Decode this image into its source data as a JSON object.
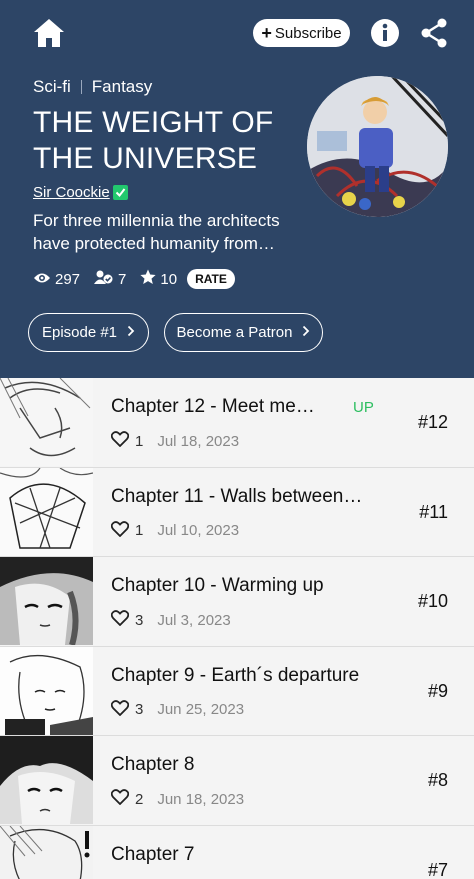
{
  "header": {
    "subscribe_label": "Subscribe",
    "genres": [
      "Sci-fi",
      "Fantasy"
    ],
    "title": "THE WEIGHT OF THE UNIVERSE",
    "author": "Sir Coockie",
    "description": "For three millennia the architects have protected humanity from…",
    "stats": {
      "views": "297",
      "subscribers": "7",
      "rating": "10",
      "rate_label": "RATE"
    },
    "buttons": {
      "episode": "Episode #1",
      "patron": "Become a Patron"
    },
    "colors": {
      "background": "#2d4566",
      "verified": "#22c86e",
      "up": "#2dbe60"
    }
  },
  "chapters": [
    {
      "title": "Chapter 12 - Meet me…",
      "likes": "1",
      "date": "Jul 18, 2023",
      "number": "#12",
      "badge": "UP"
    },
    {
      "title": "Chapter 11 - Walls between…",
      "likes": "1",
      "date": "Jul 10, 2023",
      "number": "#11"
    },
    {
      "title": "Chapter 10 - Warming up",
      "likes": "3",
      "date": "Jul 3, 2023",
      "number": "#10"
    },
    {
      "title": "Chapter 9 - Earth´s departure",
      "likes": "3",
      "date": "Jun 25, 2023",
      "number": "#9"
    },
    {
      "title": "Chapter 8",
      "likes": "2",
      "date": "Jun 18, 2023",
      "number": "#8"
    },
    {
      "title": "Chapter 7",
      "likes": "",
      "date": "",
      "number": "#7"
    }
  ]
}
